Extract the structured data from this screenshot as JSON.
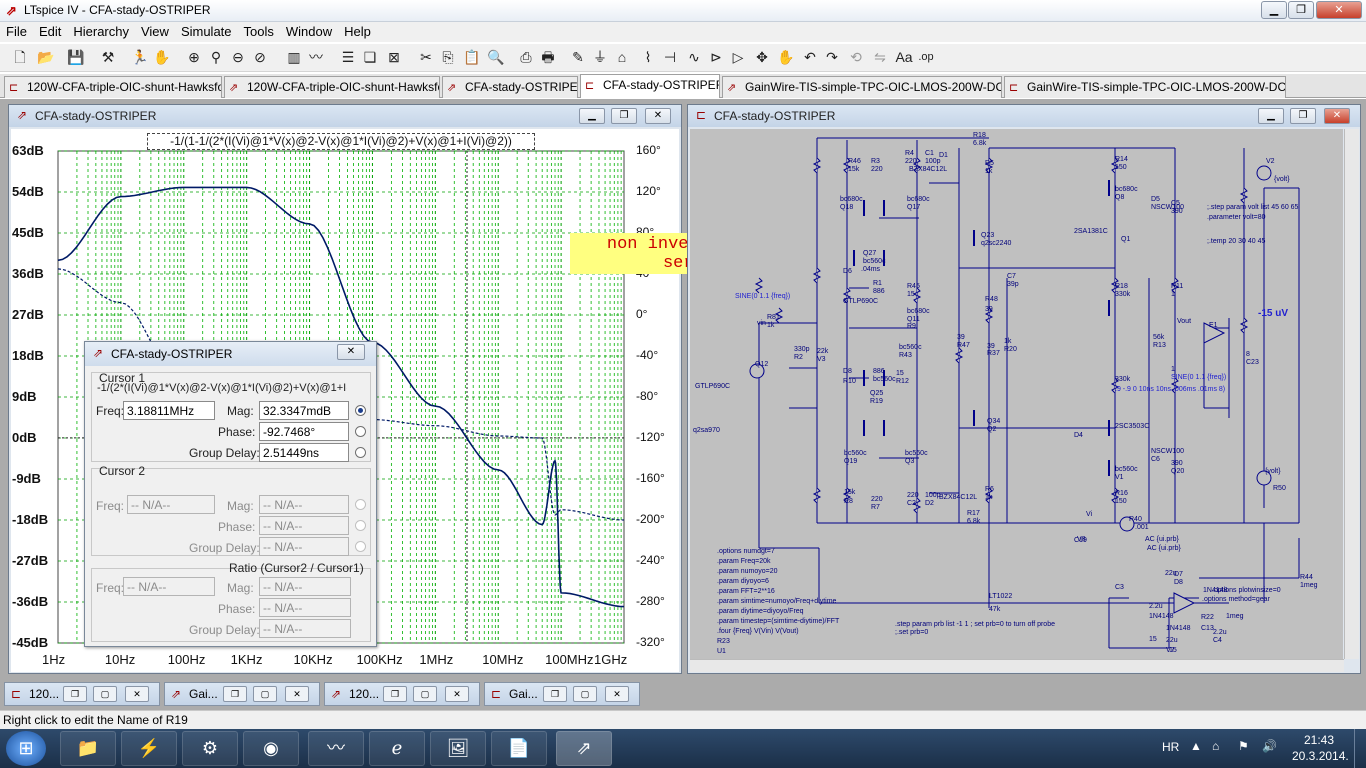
{
  "app": {
    "title": "LTspice IV - CFA-stady-OSTRIPER"
  },
  "menu": [
    "File",
    "Edit",
    "Hierarchy",
    "View",
    "Simulate",
    "Tools",
    "Window",
    "Help"
  ],
  "tabs": [
    "120W-CFA-triple-OIC-shunt-Hawksfor-2",
    "120W-CFA-triple-OIC-shunt-Hawksfor-2",
    "CFA-stady-OSTRIPER",
    "CFA-stady-OSTRIPER",
    "GainWire-TIS-simple-TPC-OIC-LMOS-200W-DCservo",
    "GainWire-TIS-simple-TPC-OIC-LMOS-200W-DCservo"
  ],
  "plot": {
    "title": "CFA-stady-OSTRIPER",
    "expression": "-1/(1-1/(2*(I(Vi)@1*V(x)@2-V(x)@1*I(Vi)@2)+V(x)@1+I(Vi)@2))",
    "note_line1": "non inverting DC",
    "note_line2": "servo",
    "y_left": [
      "63dB",
      "54dB",
      "45dB",
      "36dB",
      "27dB",
      "18dB",
      "9dB",
      "0dB",
      "-9dB",
      "-18dB",
      "-27dB",
      "-36dB",
      "-45dB"
    ],
    "y_right": [
      "160°",
      "120°",
      "80°",
      "40°",
      "0°",
      "-40°",
      "-80°",
      "-120°",
      "-160°",
      "-200°",
      "-240°",
      "-280°",
      "-320°"
    ],
    "x_labels": [
      "1Hz",
      "10Hz",
      "100Hz",
      "1KHz",
      "10KHz",
      "100KHz",
      "1MHz",
      "10MHz",
      "100MHz",
      "1GHz"
    ]
  },
  "cursor": {
    "title": "CFA-stady-OSTRIPER",
    "c1_label": "Cursor 1",
    "c1_expr": "-1/(2*(I(Vi)@1*V(x)@2-V(x)@1*I(Vi)@2)+V(x)@1+I(Vi)",
    "freq_label": "Freq:",
    "mag_label": "Mag:",
    "phase_label": "Phase:",
    "gd_label": "Group Delay:",
    "c1_freq": "3.18811MHz",
    "c1_mag": "32.3347mdB",
    "c1_phase": "-92.7468°",
    "c1_gd": "2.51449ns",
    "c2_label": "Cursor 2",
    "na": "-- N/A--",
    "ratio_label": "Ratio (Cursor2 / Cursor1)"
  },
  "schematic": {
    "title": "CFA-stady-OSTRIPER",
    "output_label": "-15 uV",
    "labels": [
      "R18",
      "6.8k",
      "R46",
      "15k",
      "R3",
      "220",
      "R4",
      "220",
      "C1",
      "100p",
      "D1",
      "BZX84C12L",
      "R5",
      "1k",
      "R14",
      "150",
      "bc680c",
      "Q18",
      "bc680c",
      "Q17",
      "bc680c",
      "Q8",
      "D5",
      "NSCW100",
      "C5",
      "390",
      "Q23",
      "q2sc2240",
      "2SA1381C",
      "Q1",
      "V2",
      "{volt}",
      ";.step param volt list 45 60 65",
      ".parameter volt=80",
      ";.temp 20 30 40 45",
      "Q27",
      "bc560c",
      ".04ms",
      "D6",
      "GTLP690C",
      "R1",
      "886",
      "R45",
      "15",
      "C7",
      "39p",
      "R48",
      "39",
      "R18",
      "330k",
      "R11",
      "1",
      "Vout",
      "E1",
      "-15 uV",
      "SINE(0 1.1 {freq})",
      "R81",
      "1k",
      "vin",
      "bc680c",
      "Q11",
      "R9",
      "39",
      "R47",
      "39",
      "R37",
      "1k",
      "R20",
      "56k",
      "R13",
      "8",
      "C23",
      "330p",
      "R2",
      "22k",
      "V3",
      "Q12",
      "bc560c",
      "R43",
      "15",
      "R12",
      "1",
      "SINE(0 1.1 {freq})",
      "GTLP690C",
      "D8",
      "R10",
      "886",
      "bc560c",
      "Q25",
      "R19",
      "330k",
      ".9 -.9 0 10ns 10ns .006ms .01ms 8)",
      "q2sa970",
      "Q34",
      "Q2",
      "2SC3503C",
      "D4",
      "NSCW100",
      "C6",
      "390",
      "Q20",
      "bc560c",
      "Q19",
      "bc560c",
      "Q3",
      "bc560c",
      "V1",
      "{volt}",
      "R50",
      "15k",
      "R8",
      "220",
      "R7",
      "220",
      "C2",
      "100p",
      "D2",
      "BZX84C12L",
      "R6",
      "1k",
      "R16",
      "150",
      "R17",
      "6.8k",
      "Vi",
      "R40",
      ".001",
      "AC {ui.prb}",
      "AC {ui.prb}",
      "C19",
      "V8",
      "C3",
      "22u",
      "D7",
      "D8",
      "1N4148",
      ".options plotwinsize=0",
      ".options method=gear",
      ".options numdgt=7",
      ".param Freq=20k",
      ".param numoyo=20",
      ".param diyoyo=6",
      ".param FFT=2**16",
      ".param simtime=numoyo/Freq+diytime",
      ".param diytime=diyoyo/Freq",
      ".param timestep=(simtime-diytime)/FFT",
      ".four {Freq} V(Vin) V(Vout)",
      "R23",
      "U1",
      "LT1022",
      "1N4148",
      "1N4148",
      "R22",
      "1meg",
      "C13",
      "2.2u",
      "C4",
      "22u",
      "V7",
      "15",
      "15",
      "R44",
      "1meg",
      ".step param prb list -1 1 ; set prb=0 to turn off probe",
      ";.set prb=0",
      "2.2u",
      "47k"
    ]
  },
  "mini": [
    "120...",
    "Gai...",
    "120...",
    "Gai..."
  ],
  "status": "Right click to edit the Name of R19",
  "taskbar": {
    "lang": "HR",
    "time": "21:43",
    "date": "20.3.2014."
  },
  "chart_data": {
    "type": "line",
    "xscale": "log",
    "xlim": [
      1,
      1000000000
    ],
    "ylim_left": [
      -45,
      63
    ],
    "ylim_right": [
      -320,
      160
    ],
    "x": [
      1,
      10,
      100,
      1000,
      10000,
      100000,
      1000000,
      10000000,
      50000000,
      80000000,
      100000000,
      1000000000
    ],
    "series": [
      {
        "axis": "left",
        "style": "solid",
        "values": [
          39,
          53,
          55,
          55,
          47,
          21,
          7,
          -7,
          -19,
          -5,
          -34,
          -37
        ]
      },
      {
        "axis": "right",
        "style": "dashed",
        "values": [
          45,
          12,
          -70,
          -105,
          -100,
          -102,
          -108,
          -118,
          -120,
          -195,
          -190,
          -200
        ]
      }
    ]
  }
}
